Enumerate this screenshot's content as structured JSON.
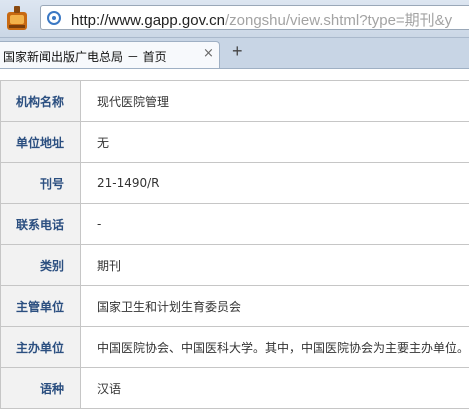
{
  "browser": {
    "url_host": "http://www.gapp.gov.cn",
    "url_path": "/zongshu/view.shtml?type=期刊&y"
  },
  "tabs": [
    {
      "title": "国家新闻出版广电总局 － 首页",
      "close": "×"
    }
  ],
  "new_tab_label": "+",
  "fields": [
    {
      "label": "机构名称",
      "value": "现代医院管理"
    },
    {
      "label": "单位地址",
      "value": "无"
    },
    {
      "label": "刊号",
      "value": "21-1490/R"
    },
    {
      "label": "联系电话",
      "value": "-"
    },
    {
      "label": "类别",
      "value": "期刊"
    },
    {
      "label": "主管单位",
      "value": "国家卫生和计划生育委员会"
    },
    {
      "label": "主办单位",
      "value": "中国医院协会、中国医科大学。其中，中国医院协会为主要主办单位。"
    },
    {
      "label": "语种",
      "value": "汉语"
    }
  ]
}
